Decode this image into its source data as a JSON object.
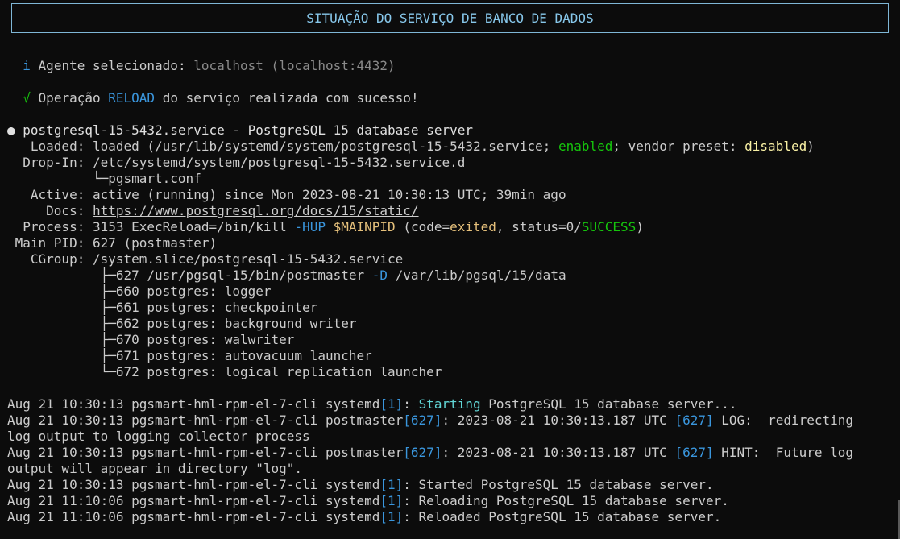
{
  "header": {
    "title": "SITUAÇÃO DO SERVIÇO DE BANCO DE DADOS"
  },
  "agent": {
    "icon": "i",
    "label": "Agente selecionado:",
    "value": "localhost (localhost:4432)"
  },
  "operation": {
    "icon": "√",
    "pre": "Operação",
    "action": "RELOAD",
    "post": "do serviço realizada com sucesso!"
  },
  "service": {
    "bullet": "●",
    "title": "postgresql-15-5432.service - PostgreSQL 15 database server",
    "loaded_key": "   Loaded:",
    "loaded_pre": "loaded (/usr/lib/systemd/system/postgresql-15-5432.service;",
    "loaded_enabled": "enabled",
    "loaded_mid": "; vendor preset:",
    "loaded_disabled": "disabled",
    "loaded_post": ")",
    "dropin_key": "  Drop-In:",
    "dropin_value": "/etc/systemd/system/postgresql-15-5432.service.d",
    "dropin_child": "           └─pgsmart.conf",
    "active_key": "   Active:",
    "active_value": "active (running) since Mon 2023-08-21 10:30:13 UTC; 39min ago",
    "docs_key": "     Docs:",
    "docs_value": "https://www.postgresql.org/docs/15/static/",
    "process_key": "  Process:",
    "process_pre": "3153 ExecReload=/bin/kill",
    "process_flag": "-HUP",
    "process_var": "$MAINPID",
    "process_code_pre": "(code=",
    "process_code": "exited",
    "process_status_pre": ", status=0/",
    "process_status": "SUCCESS",
    "process_post": ")",
    "mainpid_key": " Main PID:",
    "mainpid_value": "627 (postmaster)",
    "cgroup_key": "   CGroup:",
    "cgroup_value": "/system.slice/postgresql-15-5432.service",
    "cgroup_first_pre": "            ├─627 /usr/pgsql-15/bin/postmaster",
    "cgroup_first_flag": "-D",
    "cgroup_first_post": "/var/lib/pgsql/15/data",
    "cgroup_children": [
      "            ├─660 postgres: logger",
      "            ├─661 postgres: checkpointer",
      "            ├─662 postgres: background writer",
      "            ├─670 postgres: walwriter",
      "            ├─671 postgres: autovacuum launcher",
      "            └─672 postgres: logical replication launcher"
    ]
  },
  "logs": {
    "l1_pre": "Aug 21 10:30:13 pgsmart-hml-rpm-el-7-cli systemd",
    "l1_pid": "[1]",
    "l1_colon": ":",
    "l1_word": "Starting",
    "l1_post": "PostgreSQL 15 database server...",
    "l2_pre": "Aug 21 10:30:13 pgsmart-hml-rpm-el-7-cli postmaster",
    "l2_pid": "[627]",
    "l2_mid": ": 2023-08-21 10:30:13.187 UTC",
    "l2_pid2": "[627]",
    "l2_post": "LOG:  redirecting",
    "l2_cont": "log output to logging collector process",
    "l3_pre": "Aug 21 10:30:13 pgsmart-hml-rpm-el-7-cli postmaster",
    "l3_pid": "[627]",
    "l3_mid": ": 2023-08-21 10:30:13.187 UTC",
    "l3_pid2": "[627]",
    "l3_post": "HINT:  Future log",
    "l3_cont": "output will appear in directory \"log\".",
    "l4_pre": "Aug 21 10:30:13 pgsmart-hml-rpm-el-7-cli systemd",
    "l4_pid": "[1]",
    "l4_post": ": Started PostgreSQL 15 database server.",
    "l5_pre": "Aug 21 11:10:06 pgsmart-hml-rpm-el-7-cli systemd",
    "l5_pid": "[1]",
    "l5_post": ": Reloading PostgreSQL 15 database server.",
    "l6_pre": "Aug 21 11:10:06 pgsmart-hml-rpm-el-7-cli systemd",
    "l6_pid": "[1]",
    "l6_post": ": Reloaded PostgreSQL 15 database server."
  },
  "colors": {
    "background": "#0c0c0c",
    "foreground": "#cccccc",
    "accent_blue": "#3a96dd",
    "accent_cyan": "#61d6d6",
    "ok_green": "#16c60c",
    "warn_yellow": "#f9f1a5"
  }
}
